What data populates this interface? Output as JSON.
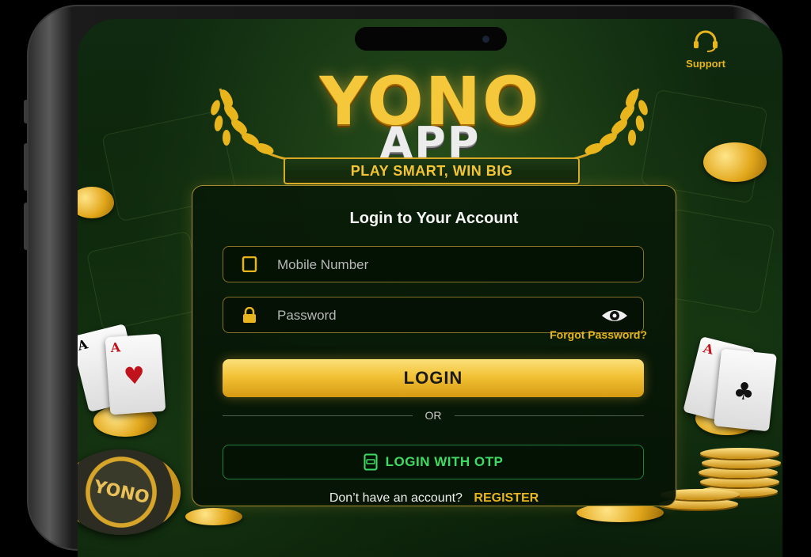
{
  "support": {
    "label": "Support",
    "icon": "headset-icon"
  },
  "brand": {
    "title_main": "YONO",
    "title_sub": "APP",
    "tagline": "PLAY SMART, WIN BIG"
  },
  "login_panel": {
    "title": "Login to Your Account",
    "mobile": {
      "placeholder": "Mobile Number",
      "value": "",
      "icon": "phone-icon"
    },
    "password": {
      "placeholder": "Password",
      "value": "",
      "icon": "lock-icon",
      "toggle_icon": "eye-icon"
    },
    "forgot_password": "Forgot Password?",
    "login_button": "LOGIN",
    "or_text": "OR",
    "otp_button": "LOGIN WITH OTP",
    "otp_icon": "otp-message-icon",
    "register_prompt": "Don’t have an account?",
    "register_link": "REGISTER"
  },
  "decor": {
    "chip_text": "YONO",
    "card_left": {
      "rank": "A",
      "suit": "♥"
    },
    "card_right": {
      "rank": "A",
      "suit": "♣"
    }
  },
  "colors": {
    "gold": "#e8b51c",
    "green_accent": "#3fdc63",
    "background": "#0b2309"
  }
}
